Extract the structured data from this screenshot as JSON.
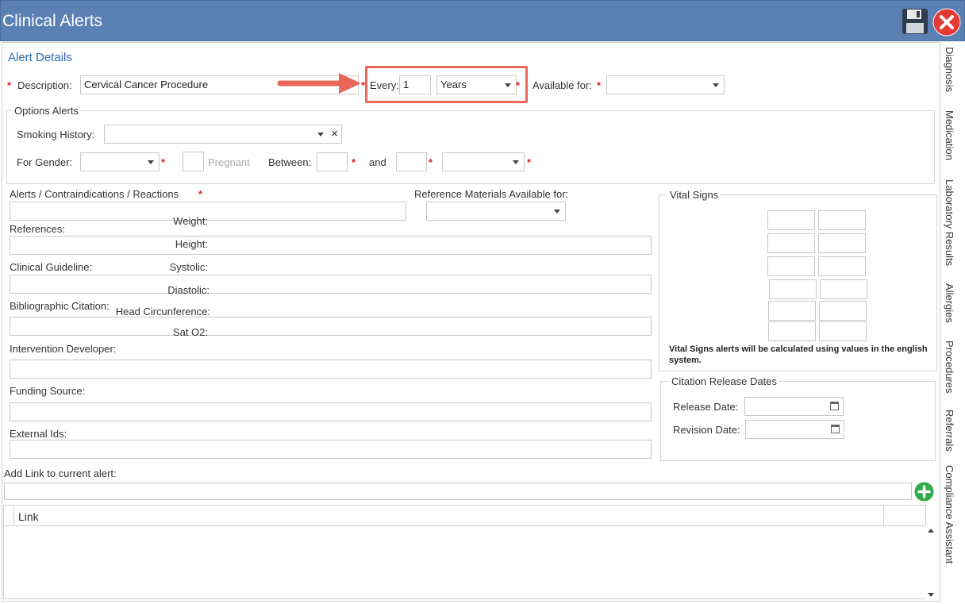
{
  "window": {
    "title": "Clinical Alerts",
    "save_icon": "floppy-disk-icon",
    "close_icon": "close-icon"
  },
  "alert_details": {
    "heading": "Alert Details",
    "description_label": "Description:",
    "description_value": "Cervical Cancer Procedure",
    "every_label": "Every:",
    "every_value": "1",
    "every_unit": "Years",
    "available_for_label": "Available for:",
    "available_for_value": "",
    "required_mark": "*"
  },
  "options_alerts": {
    "legend": "Options Alerts",
    "smoking_label": "Smoking History:",
    "smoking_value": "",
    "clear_glyph": "×",
    "gender_label": "For Gender:",
    "gender_value": "",
    "pregnant_label": "Pregnant",
    "between_label": "Between:",
    "between_from": "",
    "and_label": "and",
    "between_to": "",
    "age_unit_value": ""
  },
  "fields": {
    "alerts_label": "Alerts / Contraindications / Reactions",
    "reference_materials_label": "Reference Materials Available for:",
    "references_label": "References:",
    "clinical_guideline_label": "Clinical Guideline:",
    "bibliographic_label": "Bibliographic Citation:",
    "intervention_label": "Intervention Developer:",
    "funding_label": "Funding Source:",
    "external_ids_label": "External Ids:",
    "add_link_label": "Add Link to current alert:",
    "add_link_icon": "plus-circle-icon"
  },
  "vital_signs": {
    "legend": "Vital Signs",
    "rows": [
      "Weight:",
      "Height:",
      "Systolic:",
      "Diastolic:",
      "Head Circunference:",
      "Sat O2:"
    ],
    "note": "Vital Signs alerts will be calculated using values in the english system."
  },
  "citation_dates": {
    "legend": "Citation Release Dates",
    "release_label": "Release Date:",
    "revision_label": "Revision Date:",
    "calendar_icon": "calendar-icon"
  },
  "links_grid": {
    "column": "Link"
  },
  "side_tabs": [
    "Diagnosis",
    "Medication",
    "Laboratory Results",
    "Allergies",
    "Procedures",
    "Referrals",
    "Compliance Assistant"
  ],
  "colors": {
    "titlebar": "#5b80b4",
    "heading": "#2a6ab4",
    "required": "#e02020",
    "highlight": "#e8675a",
    "add_button": "#2eaa4a",
    "close_button": "#e53935"
  }
}
